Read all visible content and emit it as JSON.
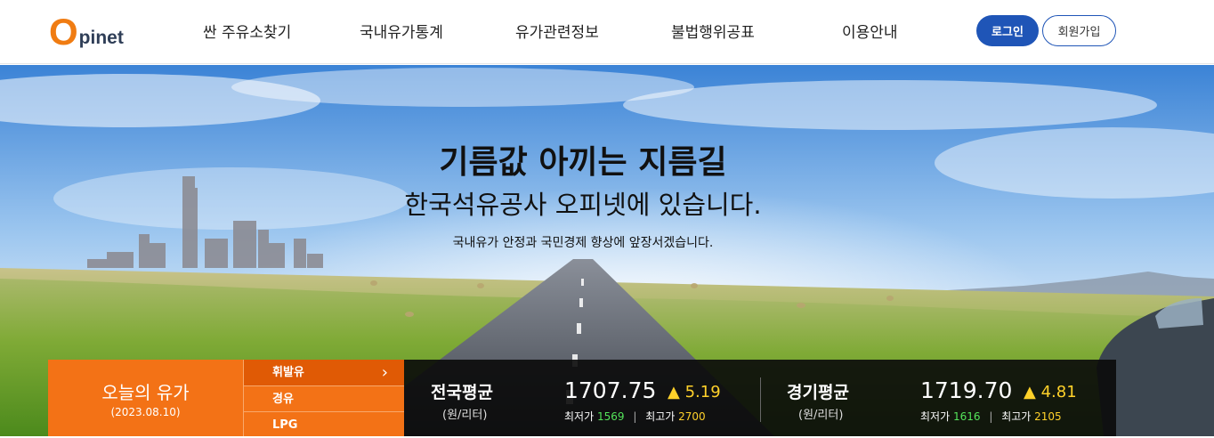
{
  "logo": {
    "first": "O",
    "rest": "pinet"
  },
  "nav": [
    {
      "label": "싼 주유소찾기"
    },
    {
      "label": "국내유가통계"
    },
    {
      "label": "유가관련정보"
    },
    {
      "label": "불법행위공표"
    },
    {
      "label": "이용안내"
    }
  ],
  "auth": {
    "login": "로그인",
    "join": "회원가입"
  },
  "hero": {
    "title": "기름값 아끼는 지름길",
    "subtitle": "한국석유공사 오피넷에 있습니다.",
    "description": "국내유가 안정과 국민경제 향상에 앞장서겠습니다."
  },
  "today": {
    "title": "오늘의 유가",
    "date": "(2023.08.10)"
  },
  "fuel_tabs": [
    {
      "label": "휘발유",
      "active": true
    },
    {
      "label": "경유",
      "active": false
    },
    {
      "label": "LPG",
      "active": false
    }
  ],
  "regions": [
    {
      "name": "전국평균",
      "unit": "(원/리터)",
      "price": "1707.75",
      "change": "▲ 5.19",
      "min_label": "최저가",
      "min": "1569",
      "max_label": "최고가",
      "max": "2700"
    },
    {
      "name": "경기평균",
      "unit": "(원/리터)",
      "price": "1719.70",
      "change": "▲ 4.81",
      "min_label": "최저가",
      "min": "1616",
      "max_label": "최고가",
      "max": "2105"
    }
  ],
  "colors": {
    "accent_orange": "#f37216",
    "brand_blue": "#1f55b7",
    "up_yellow": "#ffd12a",
    "low_green": "#54e35a"
  }
}
